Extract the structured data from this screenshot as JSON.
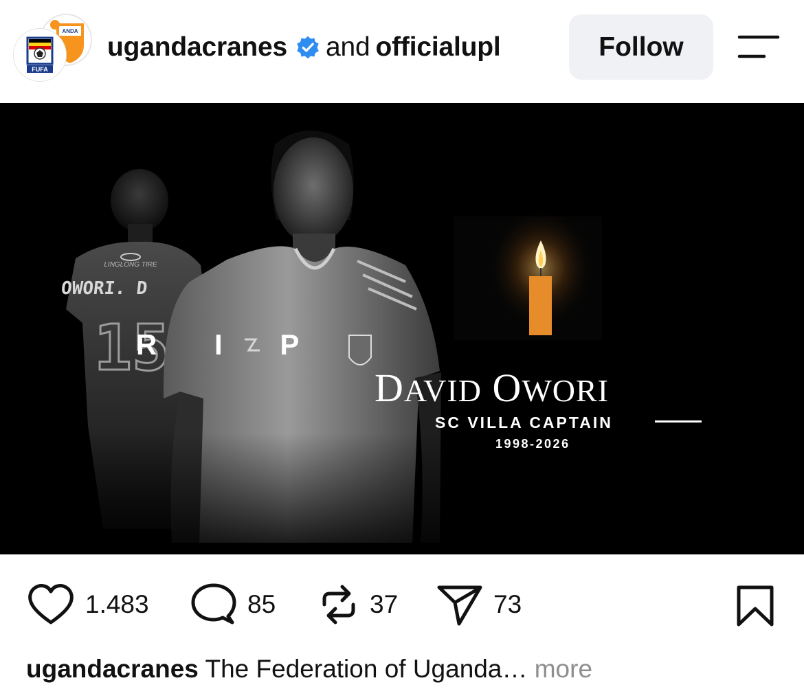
{
  "header": {
    "primary_account": "ugandacranes",
    "joiner": "and",
    "secondary_account": "officialupl",
    "follow_label": "Follow",
    "verified": true,
    "avatar_front_text": "FUFA",
    "avatar_back_text": "ANDA"
  },
  "post": {
    "jersey_name": "OWORI. D",
    "jersey_number": "15",
    "jersey_sponsor": "LINGLONG TIRE",
    "rip_label": "R I P",
    "name_first": "David",
    "name_last": "Owori",
    "role": "SC VILLA CAPTAIN",
    "years": "1998-2026",
    "candle_color": "#f2a03a"
  },
  "actions": {
    "likes": "1.483",
    "comments": "85",
    "reposts": "37",
    "shares": "73"
  },
  "caption": {
    "user": "ugandacranes",
    "text": "The Federation of Uganda…",
    "more_label": "more"
  },
  "colors": {
    "follow_bg": "#eff1f4",
    "verified_blue": "#2f8cf0",
    "muted_text": "#8e8e8e"
  }
}
